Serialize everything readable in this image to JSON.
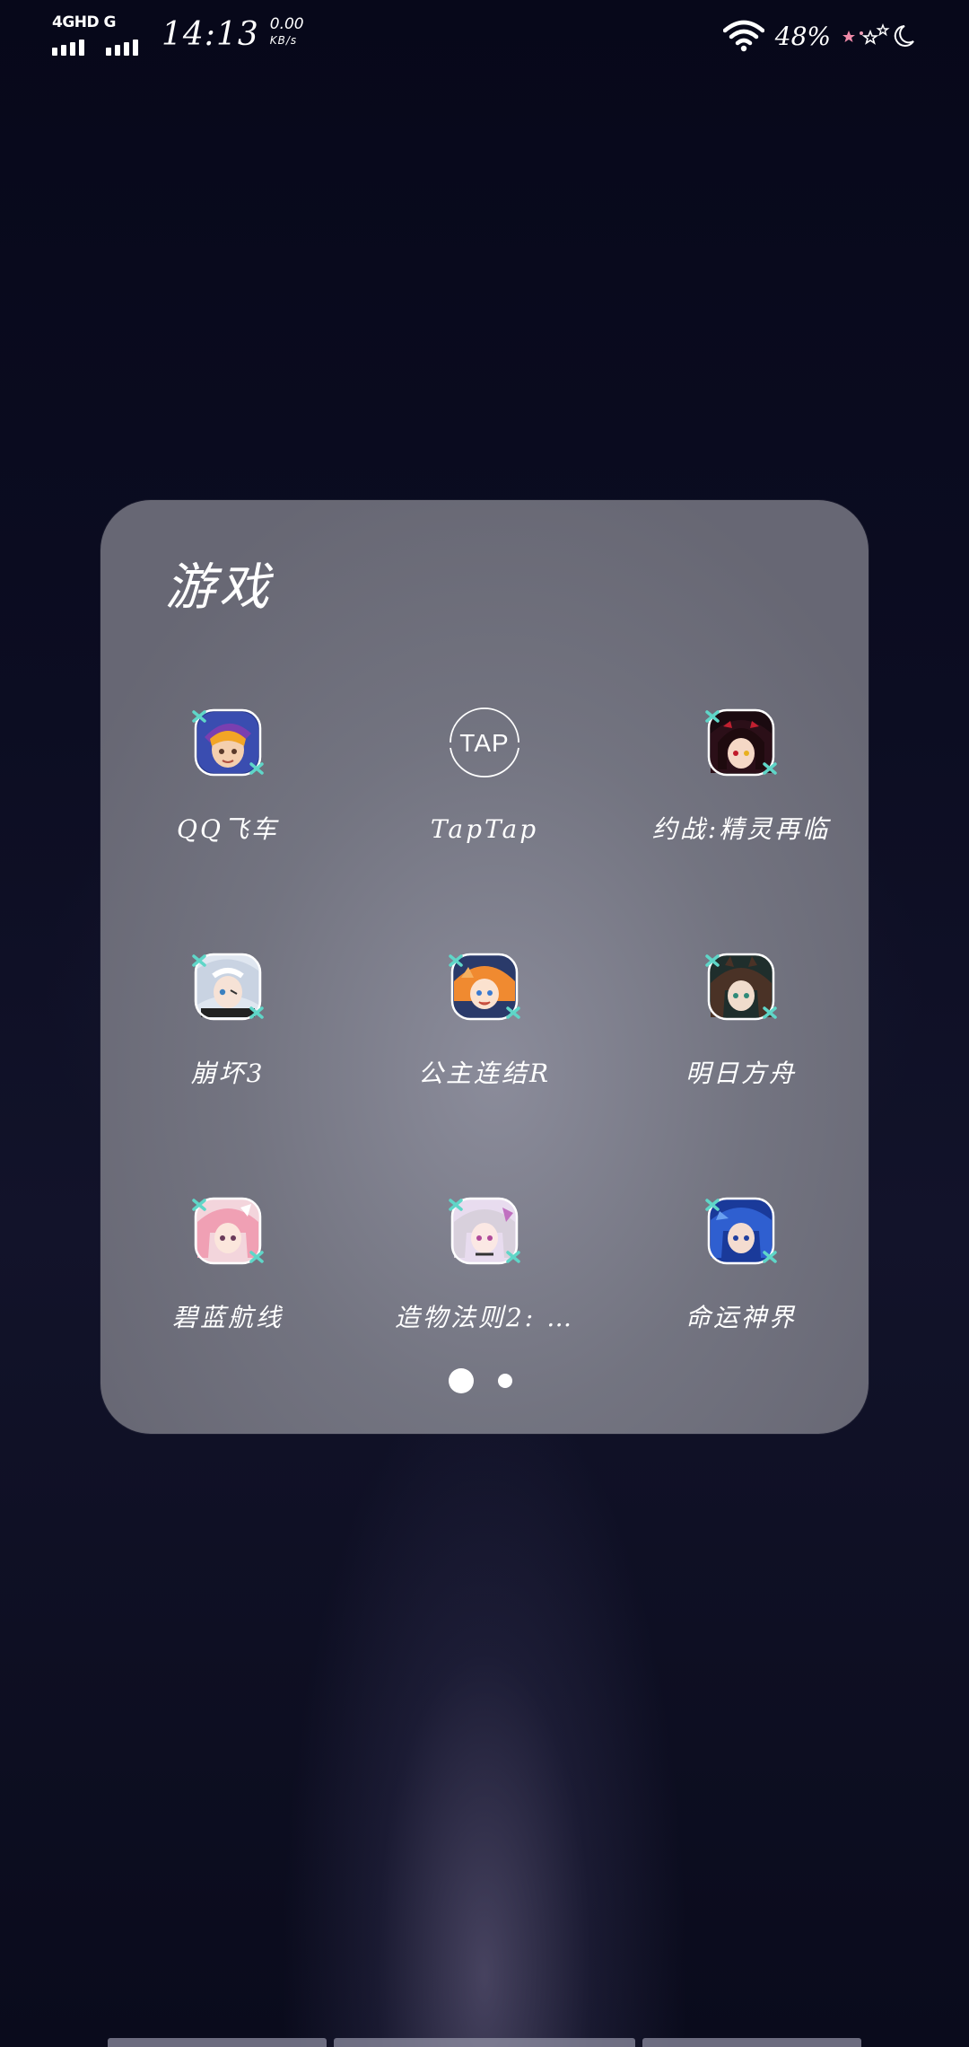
{
  "status_bar": {
    "network_label": "4GHD G",
    "time": "14:13",
    "speed_value": "0.00",
    "speed_unit": "KB/s",
    "battery": "48%",
    "icons": [
      "signal-icon",
      "signal-icon",
      "wifi-icon",
      "star-moon-deco-icon"
    ]
  },
  "folder": {
    "title": "游戏",
    "apps": [
      {
        "label": "QQ飞车",
        "icon": "qq-speed-app-icon",
        "accent": "#f0a020"
      },
      {
        "label": "TapTap",
        "icon": "taptap-app-icon",
        "accent": "#ffffff"
      },
      {
        "label": "约战:精灵再临",
        "icon": "date-a-live-app-icon",
        "accent": "#c02030"
      },
      {
        "label": "崩坏3",
        "icon": "honkai-3-app-icon",
        "accent": "#8fb0d8"
      },
      {
        "label": "公主连结R",
        "icon": "princess-connect-app-icon",
        "accent": "#f08a30"
      },
      {
        "label": "明日方舟",
        "icon": "arknights-app-icon",
        "accent": "#3a5a52"
      },
      {
        "label": "碧蓝航线",
        "icon": "azur-lane-app-icon",
        "accent": "#f0a0b0"
      },
      {
        "label": "造物法则2: …",
        "icon": "creation-rule-2-app-icon",
        "accent": "#c070c0"
      },
      {
        "label": "命运神界",
        "icon": "fate-realm-app-icon",
        "accent": "#3060d0"
      }
    ],
    "page_count": 2,
    "current_page": 1
  },
  "colors": {
    "folder_bg": "#8a8b96",
    "badge": "#5fd6c8",
    "wallpaper": "#0c0d22"
  }
}
